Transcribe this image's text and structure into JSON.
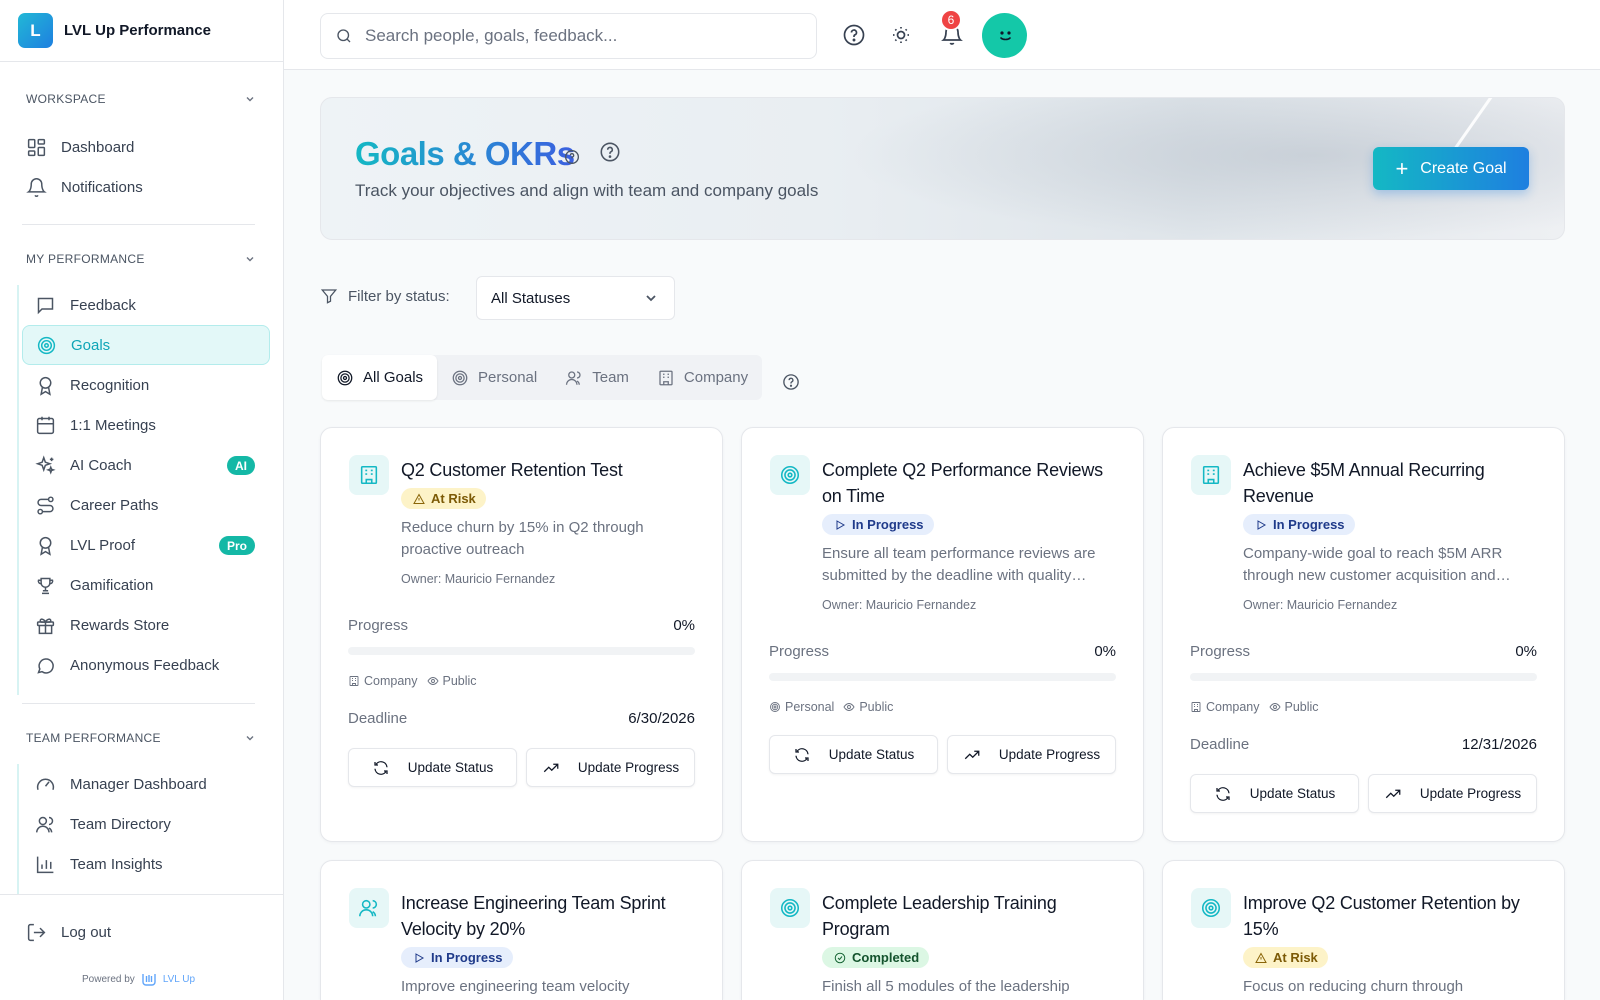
{
  "brand": {
    "logo_letter": "L",
    "name": "LVL Up Performance"
  },
  "sidebar": {
    "workspace_title": "WORKSPACE",
    "workspace_items": [
      {
        "label": "Dashboard",
        "icon": "dashboard-icon"
      },
      {
        "label": "Notifications",
        "icon": "bell-icon"
      }
    ],
    "performance_title": "MY PERFORMANCE",
    "performance_items": [
      {
        "label": "Feedback",
        "icon": "message-icon"
      },
      {
        "label": "Goals",
        "icon": "target-icon",
        "active": true
      },
      {
        "label": "Recognition",
        "icon": "award-icon"
      },
      {
        "label": "1:1 Meetings",
        "icon": "calendar-icon"
      },
      {
        "label": "AI Coach",
        "icon": "sparkles-icon",
        "badge": "AI"
      },
      {
        "label": "Career Paths",
        "icon": "route-icon"
      },
      {
        "label": "LVL Proof",
        "icon": "badge-icon",
        "badge": "Pro"
      },
      {
        "label": "Gamification",
        "icon": "trophy-icon"
      },
      {
        "label": "Rewards Store",
        "icon": "gift-icon"
      },
      {
        "label": "Anonymous Feedback",
        "icon": "chat-bubble-icon"
      }
    ],
    "team_title": "TEAM PERFORMANCE",
    "team_items": [
      {
        "label": "Manager Dashboard",
        "icon": "gauge-icon"
      },
      {
        "label": "Team Directory",
        "icon": "users-icon"
      },
      {
        "label": "Team Insights",
        "icon": "bar-chart-icon"
      }
    ],
    "logout_label": "Log out",
    "powered_by": "Powered by",
    "powered_brand": "LVL Up"
  },
  "topbar": {
    "search_placeholder": "Search people, goals, feedback...",
    "notification_count": "6"
  },
  "hero": {
    "title": "Goals & OKRs",
    "subtitle": "Track your objectives and align with team and company goals",
    "create_label": "Create Goal"
  },
  "filter": {
    "label": "Filter by status:",
    "selected": "All Statuses"
  },
  "tabs": [
    {
      "label": "All Goals",
      "active": true
    },
    {
      "label": "Personal"
    },
    {
      "label": "Team"
    },
    {
      "label": "Company"
    }
  ],
  "progress_label": "Progress",
  "deadline_label": "Deadline",
  "update_status_label": "Update Status",
  "update_progress_label": "Update Progress",
  "goals": [
    {
      "title": "Q2 Customer Retention Test",
      "status": "At Risk",
      "description": "Reduce churn by 15% in Q2 through proactive outreach",
      "owner": "Owner: Mauricio Fernandez",
      "progress": "0%",
      "progress_value": 0,
      "scope": "Company",
      "visibility": "Public",
      "deadline": "6/30/2026"
    },
    {
      "title": "Complete Q2 Performance Reviews on Time",
      "status": "In Progress",
      "description": "Ensure all team performance reviews are submitted by the deadline with quality…",
      "owner": "Owner: Mauricio Fernandez",
      "progress": "0%",
      "progress_value": 0,
      "scope": "Personal",
      "visibility": "Public"
    },
    {
      "title": "Achieve $5M Annual Recurring Revenue",
      "status": "In Progress",
      "description": "Company-wide goal to reach $5M ARR through new customer acquisition and…",
      "owner": "Owner: Mauricio Fernandez",
      "progress": "0%",
      "progress_value": 0,
      "scope": "Company",
      "visibility": "Public",
      "deadline": "12/31/2026"
    },
    {
      "title": "Increase Engineering Team Sprint Velocity by 20%",
      "status": "In Progress",
      "description": "Improve engineering team velocity"
    },
    {
      "title": "Complete Leadership Training Program",
      "status": "Completed",
      "description": "Finish all 5 modules of the leadership"
    },
    {
      "title": "Improve Q2 Customer Retention by 15%",
      "status": "At Risk",
      "description": "Focus on reducing churn through"
    }
  ]
}
